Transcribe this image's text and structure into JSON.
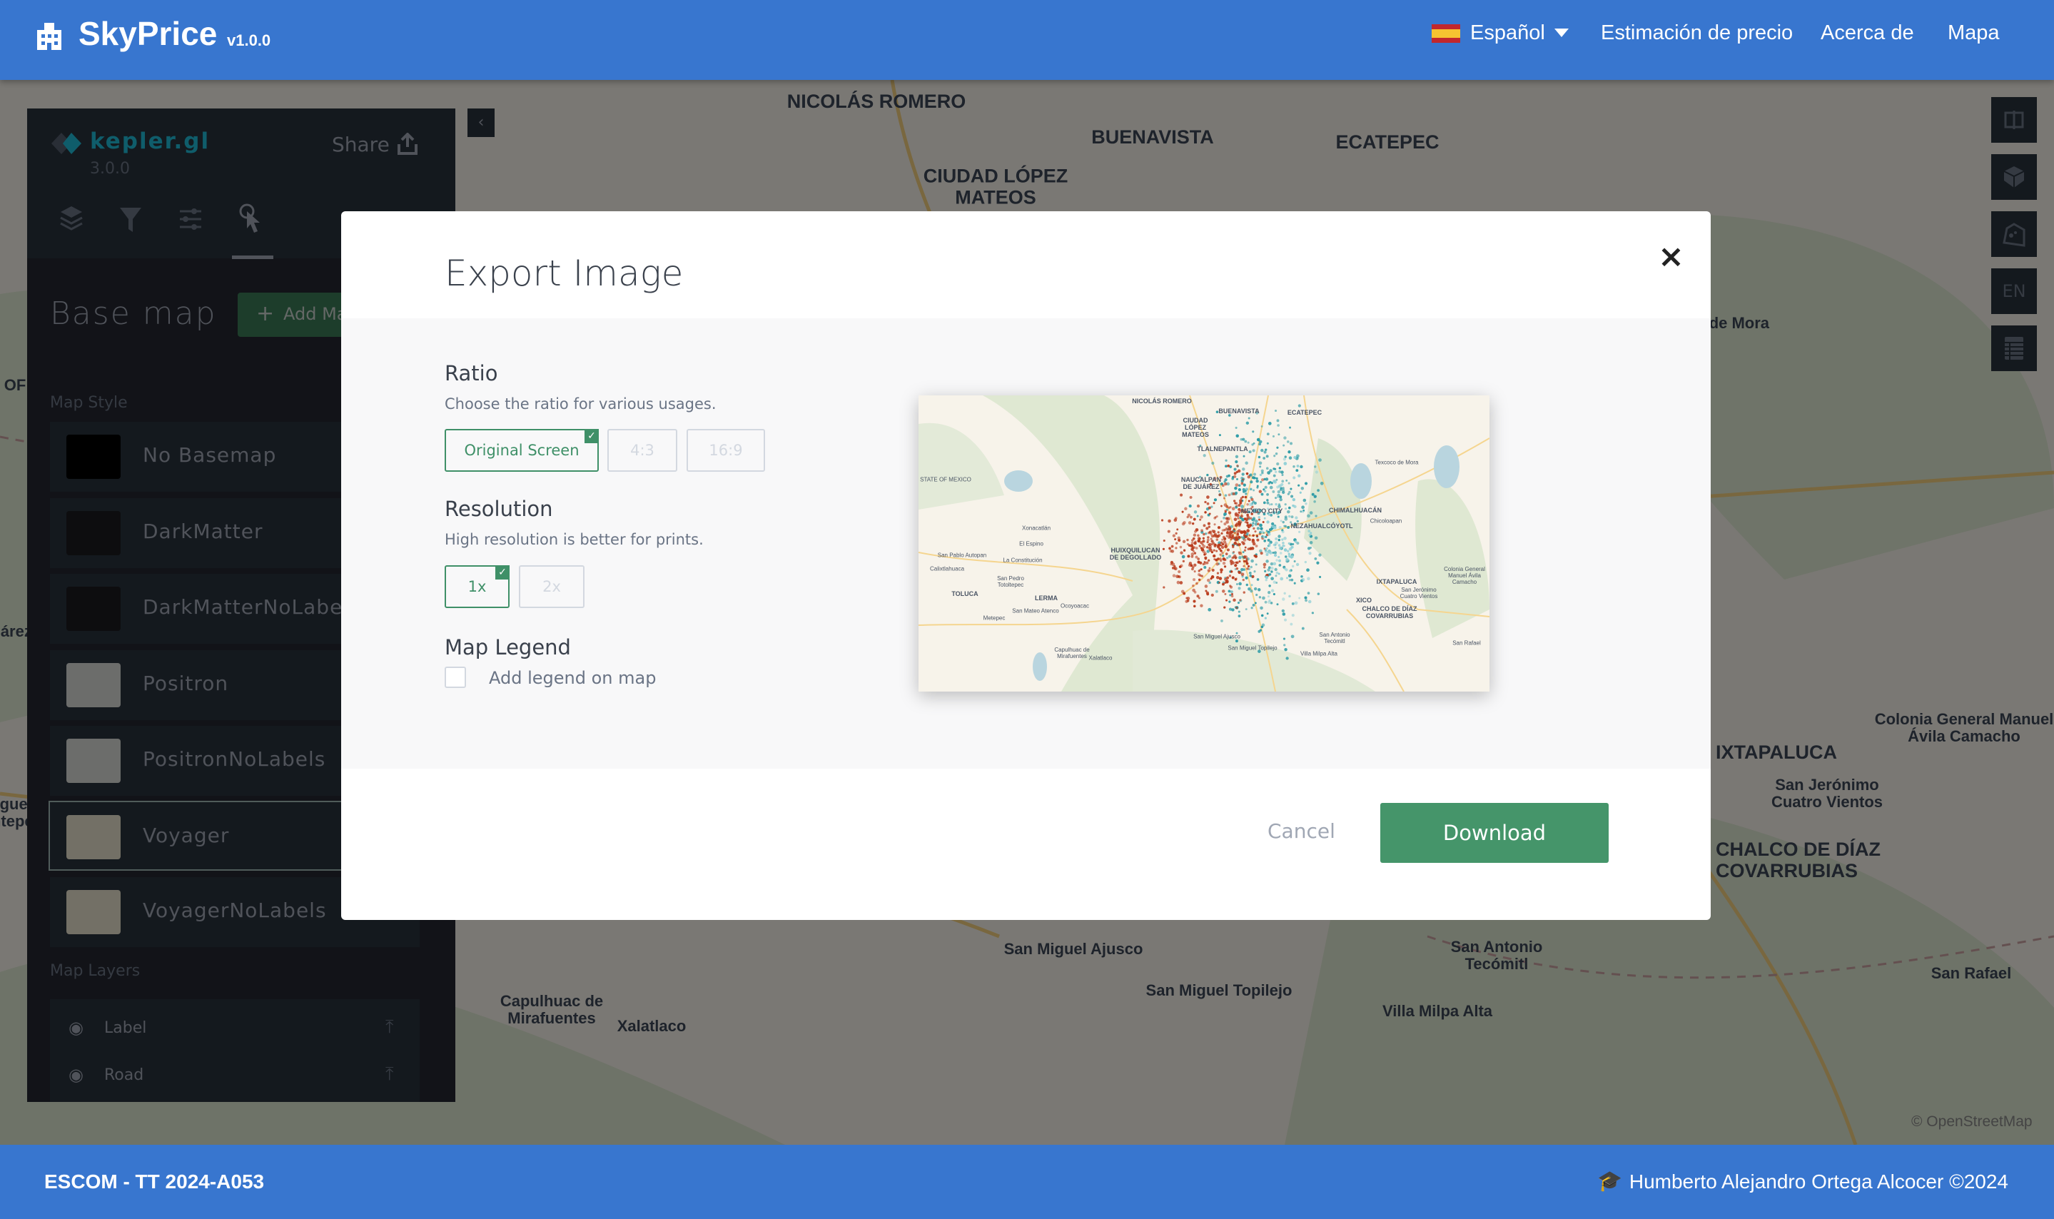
{
  "header": {
    "brand": "SkyPrice",
    "version": "v1.0.0",
    "language": "Español",
    "nav": [
      "Estimación de precio",
      "Acerca de",
      "Mapa"
    ]
  },
  "panel": {
    "logo": "kepler.gl",
    "version": "3.0.0",
    "share": "Share",
    "title": "Base map",
    "add_button": "Add Map Style",
    "map_style_label": "Map Style",
    "styles": [
      "No Basemap",
      "DarkMatter",
      "DarkMatterNoLabels",
      "Positron",
      "PositronNoLabels",
      "Voyager",
      "VoyagerNoLabels"
    ],
    "selected_style": "Voyager",
    "map_layers_label": "Map Layers",
    "layers": [
      "Label",
      "Road"
    ]
  },
  "toolbar": {
    "lang": "EN"
  },
  "map_labels": [
    "NICOLÁS ROMERO",
    "BUENAVISTA",
    "ECATEPEC",
    "CIUDAD LÓPEZ MATEOS",
    "Texcoco de Mora",
    "Colonia General Manuel Ávila Camacho",
    "IXTAPALUCA",
    "San Jerónimo Cuatro Vientos",
    "CHALCO DE DÍAZ COVARRUBIAS",
    "San Miguel Ajusco",
    "San Antonio Tecómitl",
    "San Rafael",
    "San Miguel Topilejo",
    "Villa Milpa Alta",
    "Capulhuac de Mirafuentes",
    "Xalatlaco",
    "STATE OF MEXICO",
    "Juárez",
    "Miguel Santepec",
    "© OpenStreetMap"
  ],
  "modal": {
    "title": "Export Image",
    "close": "×",
    "ratio": {
      "label": "Ratio",
      "desc": "Choose the ratio for various usages.",
      "options": [
        "Original Screen",
        "4:3",
        "16:9"
      ],
      "selected": "Original Screen"
    },
    "resolution": {
      "label": "Resolution",
      "desc": "High resolution is better for prints.",
      "options": [
        "1x",
        "2x"
      ],
      "selected": "1x"
    },
    "legend": {
      "label": "Map Legend",
      "checkbox": "Add legend on map",
      "checked": false
    },
    "cancel": "Cancel",
    "download": "Download"
  },
  "preview_labels": [
    "NICOLÁS ROMERO",
    "BUENAVISTA",
    "ECATEPEC",
    "CIUDAD LÓPEZ MATEOS",
    "TLALNEPANTLA",
    "Texcoco de Mora",
    "STATE OF MEXICO",
    "NAUCALPAN DE JUÁREZ",
    "MEXICO CITY",
    "CHIMALHUACÁN",
    "Chicoloapan",
    "NEZAHUALCÓYOTL",
    "Xonacatlán",
    "El Espino",
    "HUIXQUILUCAN DE DEGOLLADO",
    "San Pablo Autopan",
    "La Constitución",
    "Calixtlahuaca",
    "Colonia General Manuel Ávila Camacho",
    "San Pedro Totoltepec",
    "IXTAPALUCA",
    "San Jerónimo Cuatro Vientos",
    "TOLUCA",
    "LERMA",
    "XICO",
    "Ocoyoacac",
    "San Mateo Atenco",
    "CHALCO DE DÍAZ COVARRUBIAS",
    "Metepec",
    "San Miguel Ajusco",
    "San Antonio Tecómitl",
    "San Rafael",
    "San Miguel Topilejo",
    "Capulhuac de Mirafuentes",
    "Xalatlaco",
    "Villa Milpa Alta"
  ],
  "footer": {
    "left": "ESCOM - TT 2024-A053",
    "right": "Humberto Alejandro Ortega Alcocer ©2024"
  },
  "colors": {
    "brand": "#3876cf",
    "accent": "#3f9068",
    "panel": "#242730",
    "teal": "#1fbad6",
    "dot_red": "#b8391a",
    "dot_teal": "#2a9aa5"
  }
}
